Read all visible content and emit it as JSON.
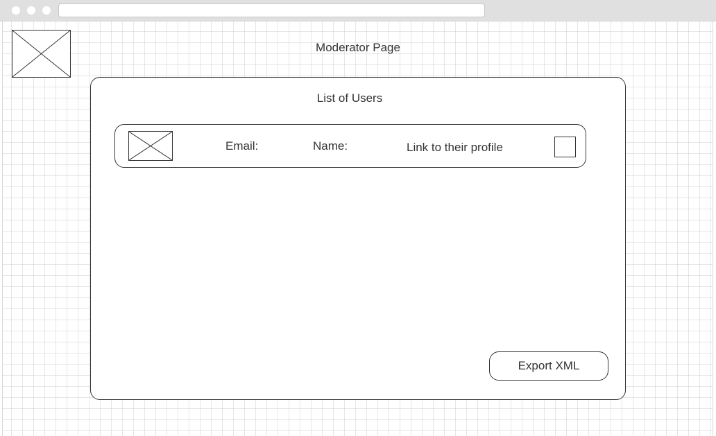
{
  "header": {
    "title": "Moderator Page"
  },
  "users_panel": {
    "title": "List of Users",
    "rows": [
      {
        "email_label": "Email:",
        "name_label": "Name:",
        "profile_link": "Link to their profile",
        "checked": false
      }
    ],
    "export_button_label": "Export XML"
  },
  "colors": {
    "line": "#333333",
    "grid": "#c8c8c8",
    "browser_chrome": "#e0e0e0"
  },
  "icons": {
    "logo": "image-placeholder-icon",
    "avatar": "image-placeholder-icon"
  }
}
